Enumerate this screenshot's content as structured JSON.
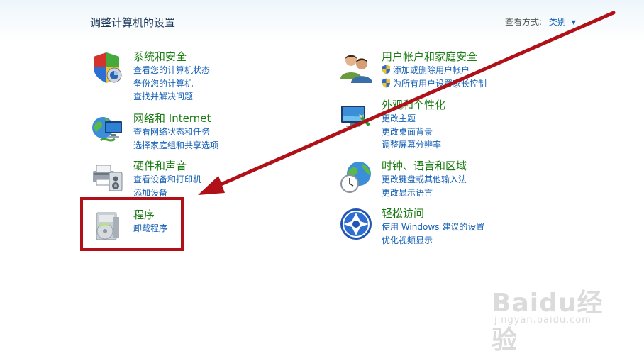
{
  "header": {
    "title": "调整计算机的设置",
    "view_by_label": "查看方式:",
    "view_by_value": "类别"
  },
  "categories": [
    {
      "icon": "system-security-icon",
      "title": "系统和安全",
      "links": [
        "查看您的计算机状态",
        "备份您的计算机",
        "查找并解决问题"
      ]
    },
    {
      "icon": "network-internet-icon",
      "title": "网络和 Internet",
      "links": [
        "查看网络状态和任务",
        "选择家庭组和共享选项"
      ]
    },
    {
      "icon": "hardware-sound-icon",
      "title": "硬件和声音",
      "links": [
        "查看设备和打印机",
        "添加设备"
      ]
    },
    {
      "icon": "programs-icon",
      "title": "程序",
      "links": [
        "卸载程序"
      ]
    },
    {
      "icon": "user-accounts-icon",
      "title": "用户帐户和家庭安全",
      "links": [
        "添加或删除用户帐户",
        "为所有用户设置家长控制"
      ]
    },
    {
      "icon": "appearance-icon",
      "title": "外观和个性化",
      "links": [
        "更改主题",
        "更改桌面背景",
        "调整屏幕分辨率"
      ]
    },
    {
      "icon": "clock-language-icon",
      "title": "时钟、语言和区域",
      "links": [
        "更改键盘或其他输入法",
        "更改显示语言"
      ]
    },
    {
      "icon": "ease-of-access-icon",
      "title": "轻松访问",
      "links": [
        "使用 Windows 建议的设置",
        "优化视频显示"
      ]
    }
  ],
  "colors": {
    "title_green": "#1a7b12",
    "link_blue": "#1560b5",
    "annotation_red": "#b01017"
  },
  "watermark": {
    "brand": "Baidu经验",
    "url": "jingyan.baidu.com"
  }
}
